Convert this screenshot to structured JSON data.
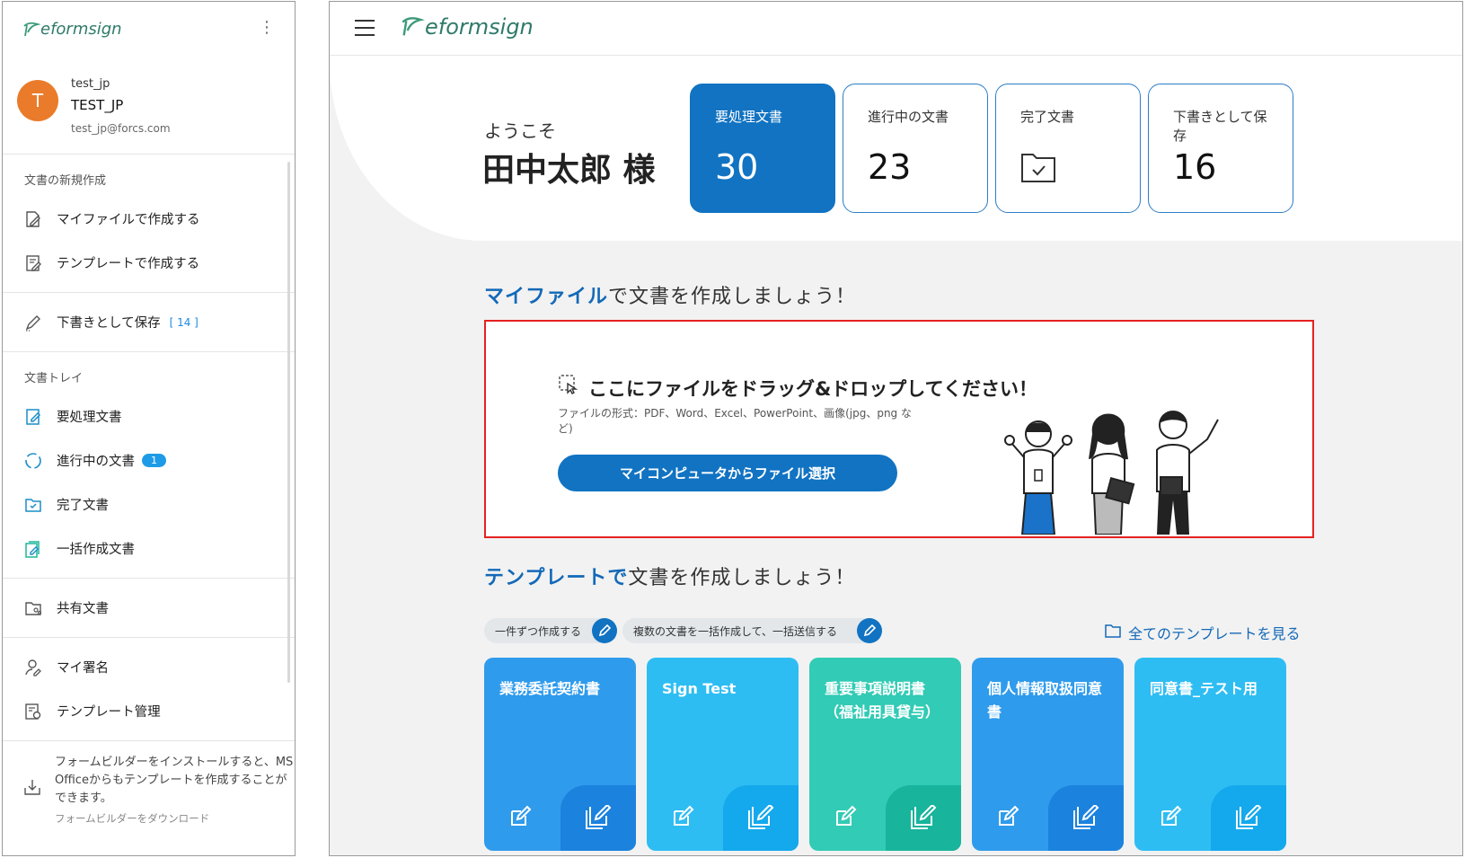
{
  "brand": {
    "logo_text": "eformsign"
  },
  "user": {
    "avatar_letter": "T",
    "id": "test_jp",
    "name": "TEST_JP",
    "email": "test_jp@forcs.com"
  },
  "sidebar": {
    "new_doc_title": "文書の新規作成",
    "create_from_my_file": "マイファイルで作成する",
    "create_from_template": "テンプレートで作成する",
    "drafts_label": "下書きとして保存",
    "drafts_count": "[ 14 ]",
    "tray_title": "文書トレイ",
    "action_required": "要処理文書",
    "in_progress": "進行中の文書",
    "in_progress_badge": "1",
    "completed": "完了文書",
    "bulk_created": "一括作成文書",
    "shared": "共有文書",
    "my_signature": "マイ署名",
    "template_management": "テンプレート管理",
    "install_text": "フォームビルダーをインストールすると、MS Officeからもテンプレートを作成することができます。",
    "download_link": "フォームビルダーをダウンロード"
  },
  "welcome": {
    "greeting": "ようこそ",
    "name": "田中太郎 様"
  },
  "stats": {
    "action_required": {
      "label": "要処理文書",
      "value": "30"
    },
    "in_progress": {
      "label": "進行中の文書",
      "value": "23"
    },
    "completed": {
      "label": "完了文書"
    },
    "drafts": {
      "label": "下書きとして保存",
      "value": "16"
    }
  },
  "myfile_section": {
    "heading_highlight": "マイファイル",
    "heading_rest": "で文書を作成しましょう！",
    "drop_title": "ここにファイルをドラッグ&ドロップしてください！",
    "formats_note": "ファイルの形式：PDF、Word、Excel、PowerPoint、画像(jpg、png など)",
    "select_button": "マイコンピュータからファイル選択"
  },
  "template_section": {
    "heading_highlight": "テンプレートで",
    "heading_rest": "文書を作成しましょう！",
    "pill_single": "一件ずつ作成する",
    "pill_bulk": "複数の文書を一括作成して、一括送信する",
    "view_all": "全てのテンプレートを見る",
    "cards": [
      {
        "title": "業務委託契約書"
      },
      {
        "title": "Sign Test"
      },
      {
        "title": "重要事項説明書（福祉用具貸与）"
      },
      {
        "title": "個人情報取扱同意書"
      },
      {
        "title": "同意書_テスト用"
      }
    ]
  },
  "colors": {
    "primary": "#1173c2",
    "highlight_border": "#e52121",
    "avatar": "#ea7b2a",
    "card_teal": "#32cbb5",
    "card_blue": "#2ba7ef"
  }
}
